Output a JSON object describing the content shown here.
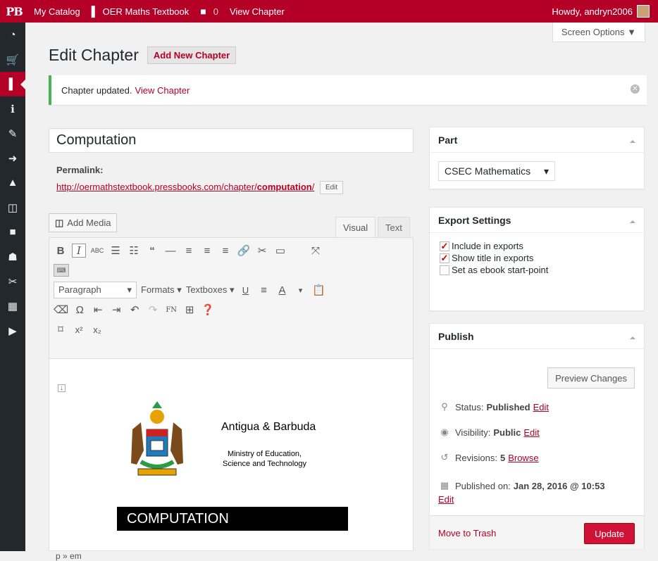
{
  "adminbar": {
    "logo": "PB",
    "my_catalog": "My Catalog",
    "book_title": "OER Maths Textbook",
    "comments_count": "0",
    "view_chapter": "View Chapter",
    "howdy": "Howdy, andryn2006"
  },
  "screen_options": "Screen Options ▼",
  "page": {
    "title": "Edit Chapter",
    "add_new": "Add New Chapter"
  },
  "notice": {
    "text": "Chapter updated.",
    "link": "View Chapter"
  },
  "post": {
    "title": "Computation",
    "permalink_label": "Permalink:",
    "permalink_base": "http://oermathstextbook.pressbooks.com/chapter/",
    "permalink_slug": "computation",
    "permalink_end": "/",
    "edit_label": "Edit"
  },
  "editor": {
    "add_media": "Add Media",
    "tab_visual": "Visual",
    "tab_text": "Text",
    "format_select": "Paragraph",
    "formats": "Formats",
    "textboxes": "Textboxes",
    "fn": "FN",
    "path": "p » em"
  },
  "document": {
    "heading": "Antigua & Barbuda",
    "ministry_line1": "Ministry of Education,",
    "ministry_line2": "Science and Technology",
    "banner": "COMPUTATION"
  },
  "part_box": {
    "title": "Part",
    "selected": "CSEC Mathematics"
  },
  "export_box": {
    "title": "Export Settings",
    "options": [
      {
        "label": "Include in exports",
        "checked": true
      },
      {
        "label": "Show title in exports",
        "checked": true
      },
      {
        "label": "Set as ebook start-point",
        "checked": false
      }
    ]
  },
  "publish_box": {
    "title": "Publish",
    "preview": "Preview Changes",
    "status_label": "Status:",
    "status_value": "Published",
    "visibility_label": "Visibility:",
    "visibility_value": "Public",
    "revisions_label": "Revisions:",
    "revisions_value": "5",
    "browse": "Browse",
    "published_label": "Published on:",
    "published_value": "Jan 28, 2016 @ 10:53",
    "edit": "Edit",
    "trash": "Move to Trash",
    "update": "Update"
  },
  "colors": {
    "brand": "#b40026",
    "notice_success": "#46b450",
    "update_button": "#d01237"
  }
}
